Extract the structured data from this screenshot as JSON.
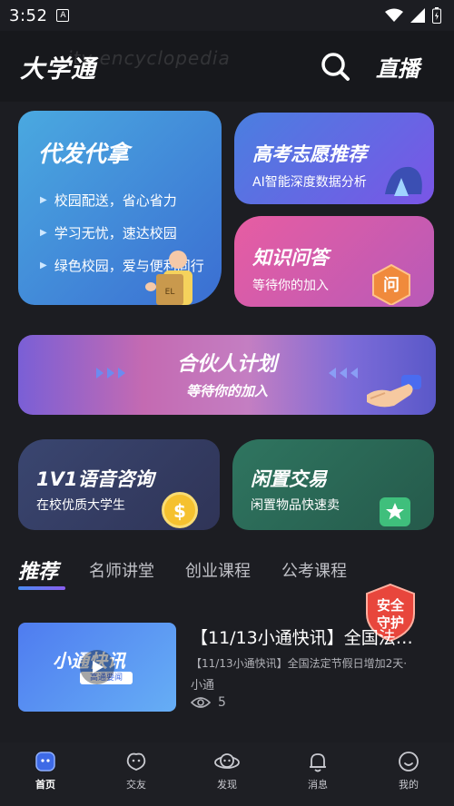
{
  "status": {
    "time": "3:52",
    "app_icon": "A"
  },
  "header": {
    "title": "大学通",
    "watermark": "ity encyclopedia",
    "live_label": "直播"
  },
  "cards": {
    "daifa": {
      "title": "代发代拿",
      "bullets": [
        "校园配送，省心省力",
        "学习无忧，速达校园",
        "绿色校园，爱与便利同行"
      ],
      "package_label": "EL"
    },
    "gaokao": {
      "title": "高考志愿推荐",
      "subtitle": "AI智能深度数据分析"
    },
    "zhishi": {
      "title": "知识问答",
      "subtitle": "等待你的加入",
      "badge": "问"
    },
    "partner": {
      "title": "合伙人计划",
      "subtitle": "等待你的加入"
    },
    "voice": {
      "title": "1V1语音咨询",
      "subtitle": "在校优质大学生",
      "coin": "$"
    },
    "trade": {
      "title": "闲置交易",
      "subtitle": "闲置物品快速卖"
    }
  },
  "tabs": [
    "推荐",
    "名师讲堂",
    "创业课程",
    "公考课程"
  ],
  "safety_badge": {
    "line1": "安全",
    "line2": "守护"
  },
  "article": {
    "thumb_title": "小通快讯",
    "thumb_badge": "高通要闻",
    "title": "【11/13小通快讯】全国法…",
    "desc": "【11/13小通快讯】全国法定节假日增加2天·",
    "author": "小通",
    "views": "5"
  },
  "nav": [
    {
      "label": "首页",
      "icon": "home-icon"
    },
    {
      "label": "交友",
      "icon": "friends-icon"
    },
    {
      "label": "发现",
      "icon": "discover-icon"
    },
    {
      "label": "消息",
      "icon": "bell-icon"
    },
    {
      "label": "我的",
      "icon": "profile-icon"
    }
  ],
  "colors": {
    "background": "#1c1d22",
    "card_daifa": "#4aa9e0",
    "card_gaokao": "#5a6fe4",
    "card_zhishi": "#d95eac",
    "card_partner": "#b86ac0",
    "card_voice": "#3a4670",
    "card_trade": "#2f7560",
    "accent_tab": "#4a8cf0"
  }
}
